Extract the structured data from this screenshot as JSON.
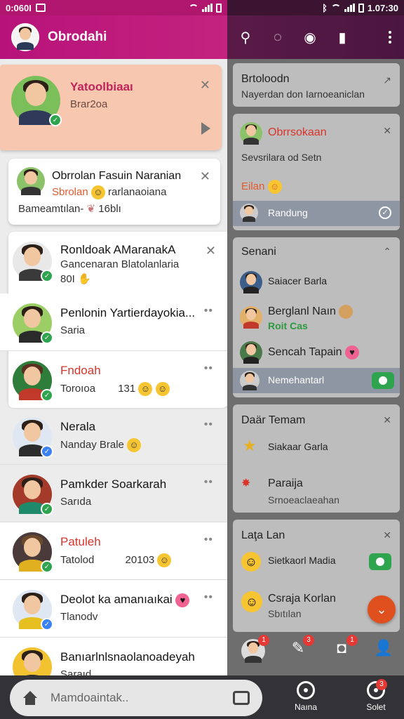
{
  "left_status": {
    "time": "0:060I"
  },
  "right_status": {
    "time": "1.07:30"
  },
  "header": {
    "title": "Obrodahi"
  },
  "highlight_card": {
    "name": "Yatoolbiaaı",
    "sub": "Brar2oa"
  },
  "notice_card": {
    "title": "Obrrolan Fasuin Naranian",
    "line2_orange": "Sbrolan",
    "line2_rest": "rarlanaoiana",
    "line3": "Bameamtılan-",
    "line3_end": "16blı"
  },
  "group_card": {
    "title": "Ronldoak AMaranakA",
    "sub": "Gancenaran Blatolanlaria",
    "sub2": "80I"
  },
  "chats": [
    {
      "name": "Penlonin Yartierdayokia...",
      "sub": "Saria",
      "name_color": "normal"
    },
    {
      "name": "Fndoah",
      "sub": "Toroıoa",
      "extra": "131",
      "name_color": "red"
    },
    {
      "name": "Nerala",
      "sub": "Nanday Brale",
      "name_color": "normal"
    },
    {
      "name": "Pamkder Soarkarah",
      "sub": "Sarıda",
      "name_color": "normal"
    },
    {
      "name": "Patuleh",
      "sub": "Tatolod",
      "extra": "20103",
      "name_color": "red"
    },
    {
      "name": "Deolot ka amanıaıkai",
      "sub": "Tlanodv",
      "name_color": "normal"
    },
    {
      "name": "Banıarlnlsnaolanoadeyah",
      "sub": "Saraıd",
      "name_color": "normal"
    }
  ],
  "search_bar": {
    "placeholder": "Mamdoaintak.."
  },
  "right_panel": {
    "card1": {
      "title": "Brtoloodn",
      "sub": "Nayerdan don Iarnoeaniclan"
    },
    "card2": {
      "title": "Obrrsokaan",
      "sub": "Sevsrilara od Setn",
      "badge": "Eilan",
      "row": "Randung"
    },
    "card3": {
      "title": "Senani",
      "items": [
        {
          "name": "Saiacer Barla"
        },
        {
          "name": "Berglanl Naın",
          "sub": "Roit Cas"
        },
        {
          "name": "Sencah Tapain"
        },
        {
          "name": "Nemehantarl"
        }
      ]
    },
    "card4": {
      "title": "Daär Temam",
      "items": [
        {
          "name": "Siakaar Garla"
        },
        {
          "name": "Paraija",
          "sub": "Srnoeaclaeahan"
        }
      ]
    },
    "card5": {
      "title": "Laţa Lan",
      "items": [
        {
          "name": "Sietkaorl Madia"
        },
        {
          "name": "Csraja Korlan",
          "sub": "Sbıtılan"
        }
      ]
    },
    "badges": [
      "1",
      "3",
      "1"
    ]
  },
  "bottom_nav": [
    {
      "label": "Naına"
    },
    {
      "label": "Solet",
      "badge": "3"
    }
  ],
  "colors": {
    "brand": "#b7127a",
    "accent_orange": "#e0501f",
    "online": "#2ea44f"
  }
}
